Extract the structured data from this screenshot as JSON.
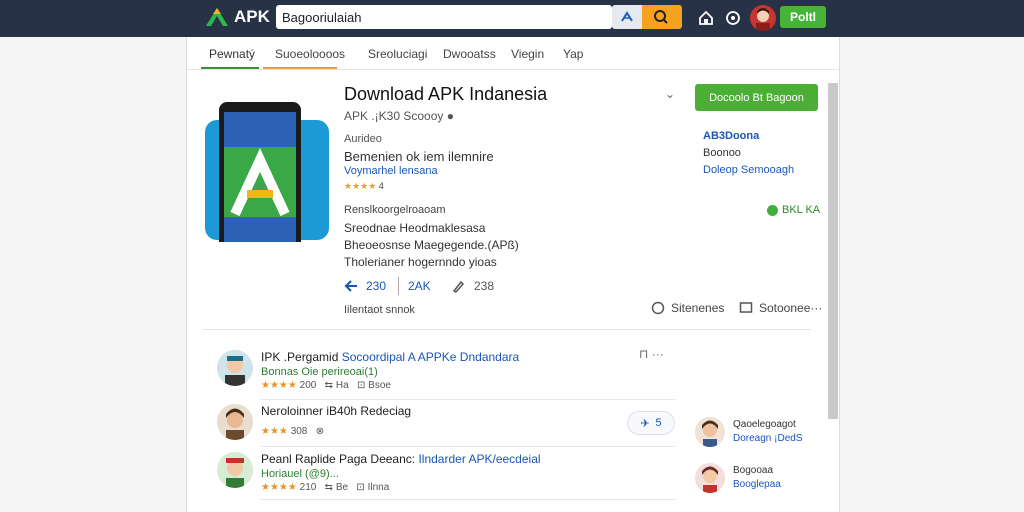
{
  "header": {
    "logo_text": "APK",
    "search_value": "Bagooriulaiah",
    "cta_label": "Poltl"
  },
  "tabs": [
    "Pewnatý",
    "Suoeoloooos",
    "Sreoluciagi",
    "Dwooatss",
    "Viegin",
    "Yap"
  ],
  "app": {
    "title": "Download APK Indanesia",
    "version_line": "APK .¡K30 Scoooy",
    "author_label": "Aurideo",
    "headline": "Bemenien ok iem ilemnire",
    "developer_link": "Voymarhel lensana",
    "rating_stars": "★★★★",
    "rating_num": "4",
    "section_label": "Renslkoorgelroaoam",
    "desc_1": "Sreodnae Heodmaklesasa",
    "desc_2": "Bheoeosnse Maegegende.(APß)",
    "desc_3": "Tholerianer hogernndo yioas",
    "actions": [
      {
        "icon": "share-icon",
        "label": "230"
      },
      {
        "icon": "text-icon",
        "label": "2AK"
      },
      {
        "icon": "pencil-icon",
        "label": "238"
      }
    ],
    "footer_text": "Iilentaot snnok",
    "share_buttons": [
      {
        "icon": "comment-icon",
        "label": "Sitenenes"
      },
      {
        "icon": "window-icon",
        "label": "Sotoonee···"
      }
    ]
  },
  "sidebar": {
    "download_label": "Docoolo Bt Bagoon",
    "line_1": "AB3Doona",
    "line_2": "Boonoo",
    "line_3": "Doleop Semooagh",
    "verified": "BKL KA"
  },
  "comments": [
    {
      "title": "IPK .Pergamid",
      "title_link": "Socoordipal A APPKe Dndandara",
      "sub": "Bonnas Oie perireoai(1)",
      "stars": "★★★★",
      "count": "200",
      "reply": "Ha",
      "views": "Bsoe"
    },
    {
      "title": "Neroloinner iB40h Redeciag",
      "title_link": "",
      "sub": "",
      "stars": "★★★",
      "count": "308",
      "reply": "",
      "views": ""
    },
    {
      "title": "Peanl Raplide Paga Deeanc:",
      "title_link": "Ilndarder APK/eecdeial",
      "sub": "Horiauel (@9)...",
      "stars": "★★★★",
      "count": "210",
      "reply": "Be",
      "views": "Ilnna"
    }
  ],
  "comment_tools": "⊓ ···",
  "like_chip": "5",
  "side_users": [
    {
      "name": "Qaoelegoagot",
      "link": "Doreagn ¡DedS"
    },
    {
      "name": "Bogooaa",
      "link": "Booglepaa"
    }
  ]
}
